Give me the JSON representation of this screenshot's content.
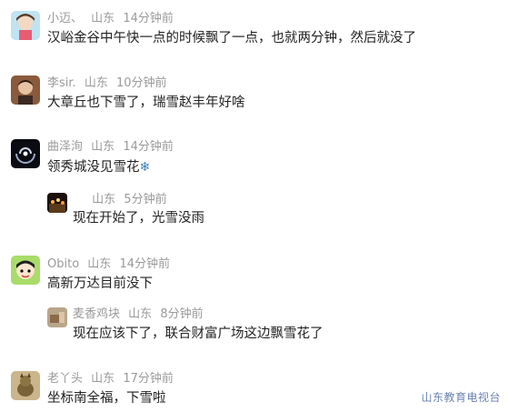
{
  "comments": [
    {
      "user": "小迈、",
      "location": "山东",
      "time": "14分钟前",
      "text": "汉峪金谷中午快一点的时候飘了一点，也就两分钟，然后就没了"
    },
    {
      "user": "李sir.",
      "location": "山东",
      "time": "10分钟前",
      "text": "大章丘也下雪了，瑞雪赵丰年好啥"
    },
    {
      "user": "曲泽洵",
      "location": "山东",
      "time": "14分钟前",
      "text": "领秀城没见雪花",
      "emoji": "❄"
    },
    {
      "user": "",
      "location": "山东",
      "time": "5分钟前",
      "text": "现在开始了，光雪没雨"
    },
    {
      "user": "Obito",
      "location": "山东",
      "time": "14分钟前",
      "text": "高新万达目前没下"
    },
    {
      "user": "麦香鸡块",
      "location": "山东",
      "time": "8分钟前",
      "text": "现在应该下了，联合财富广场这边飘雪花了"
    },
    {
      "user": "老丫头",
      "location": "山东",
      "time": "17分钟前",
      "text": "坐标南全福，下雪啦"
    }
  ],
  "watermark": "山东教育电视台"
}
